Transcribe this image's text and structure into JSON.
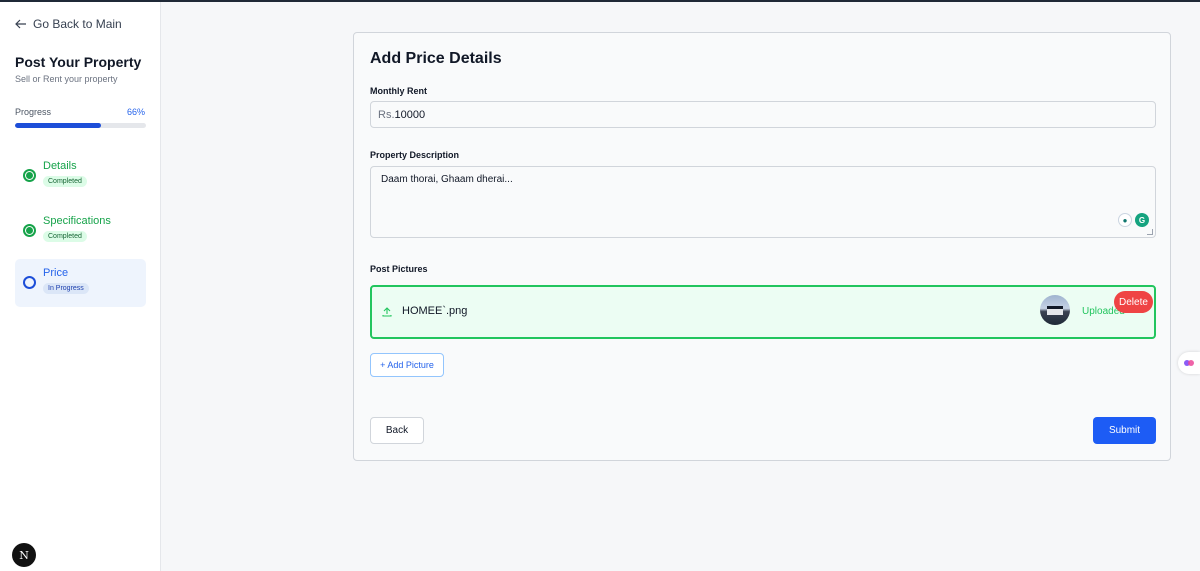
{
  "sidebar": {
    "back_label": "Go Back to Main",
    "title": "Post Your Property",
    "subtitle": "Sell or Rent your property",
    "progress_label": "Progress",
    "progress_value": "66%",
    "progress_fraction": 0.66,
    "steps": [
      {
        "name": "Details",
        "status": "Completed"
      },
      {
        "name": "Specifications",
        "status": "Completed"
      },
      {
        "name": "Price",
        "status": "In Progress"
      }
    ]
  },
  "form": {
    "title": "Add Price Details",
    "rent_label": "Monthly Rent",
    "rent_prefix": "Rs.",
    "rent_value": "10000",
    "description_label": "Property Description",
    "description_value": "Daam thorai, Ghaam dherai...",
    "pictures_label": "Post Pictures",
    "file_name": "HOMEE`.png",
    "uploaded_text": "Uploaded",
    "delete_label": "Delete",
    "add_picture_label": "+ Add Picture",
    "back_label": "Back",
    "submit_label": "Submit"
  },
  "badge": {
    "letter": "N"
  },
  "colors": {
    "primary": "#1d5cf5",
    "success": "#16a34a",
    "danger": "#ef4444"
  },
  "icons": [
    "arrow-left-icon",
    "upload-icon",
    "grammarly-icon",
    "extension-icon"
  ]
}
